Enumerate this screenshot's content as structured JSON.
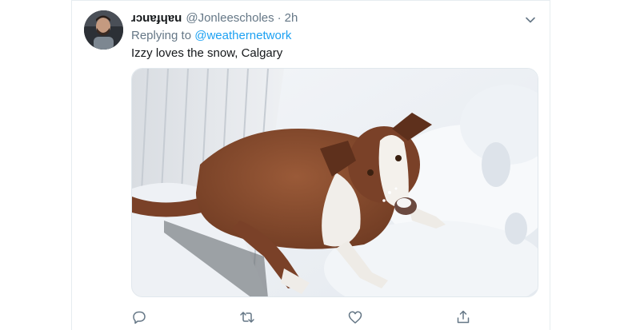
{
  "tweet": {
    "display_name": "ɹɔuɐɟɥɐu",
    "handle": "@Jonleescholes",
    "separator": "·",
    "time": "2h",
    "reply_prefix": "Replying to",
    "reply_to": "@weathernetwork",
    "text": "Izzy loves the snow, Calgary"
  },
  "media": {
    "alt": "Brown and white dog standing in deep snow next to a house wall"
  },
  "icons": {
    "caret": "chevron-down-icon",
    "reply": "reply-icon",
    "retweet": "retweet-icon",
    "like": "heart-icon",
    "share": "share-icon"
  },
  "colors": {
    "link": "#1da1f2",
    "secondary_text": "#657786",
    "primary_text": "#14171a",
    "border": "#e6ecf0"
  }
}
